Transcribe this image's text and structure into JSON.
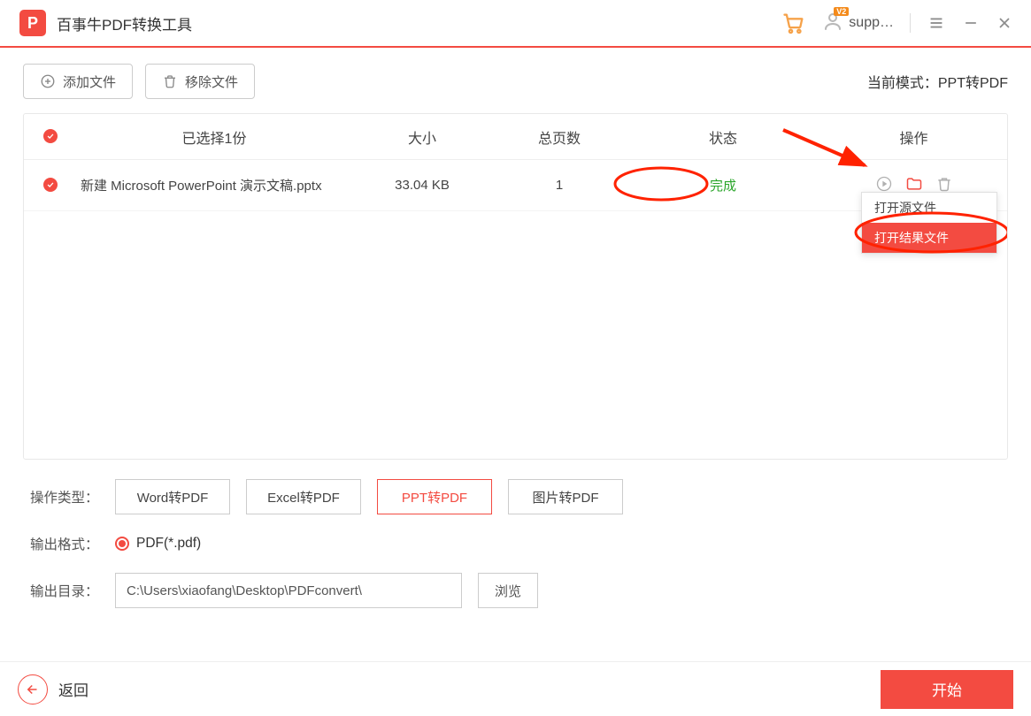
{
  "app": {
    "title": "百事牛PDF转换工具",
    "logo_letter": "P"
  },
  "header": {
    "user_label": "supp…",
    "badge": "V2"
  },
  "toolbar": {
    "add_label": "添加文件",
    "remove_label": "移除文件",
    "mode_prefix": "当前模式：",
    "mode_value": "PPT转PDF"
  },
  "table": {
    "head": {
      "name": "已选择1份",
      "size": "大小",
      "pages": "总页数",
      "status": "状态",
      "ops": "操作"
    },
    "rows": [
      {
        "name": "新建 Microsoft PowerPoint 演示文稿.pptx",
        "size": "33.04 KB",
        "pages": "1",
        "status": "完成"
      }
    ]
  },
  "menu": {
    "open_source": "打开源文件",
    "open_result": "打开结果文件"
  },
  "options": {
    "type_label": "操作类型：",
    "types": [
      {
        "label": "Word转PDF",
        "active": false
      },
      {
        "label": "Excel转PDF",
        "active": false
      },
      {
        "label": "PPT转PDF",
        "active": true
      },
      {
        "label": "图片转PDF",
        "active": false
      }
    ],
    "format_label": "输出格式：",
    "format_value": "PDF(*.pdf)",
    "dir_label": "输出目录：",
    "dir_value": "C:\\Users\\xiaofang\\Desktop\\PDFconvert\\",
    "browse": "浏览"
  },
  "footer": {
    "back": "返回",
    "start": "开始"
  }
}
